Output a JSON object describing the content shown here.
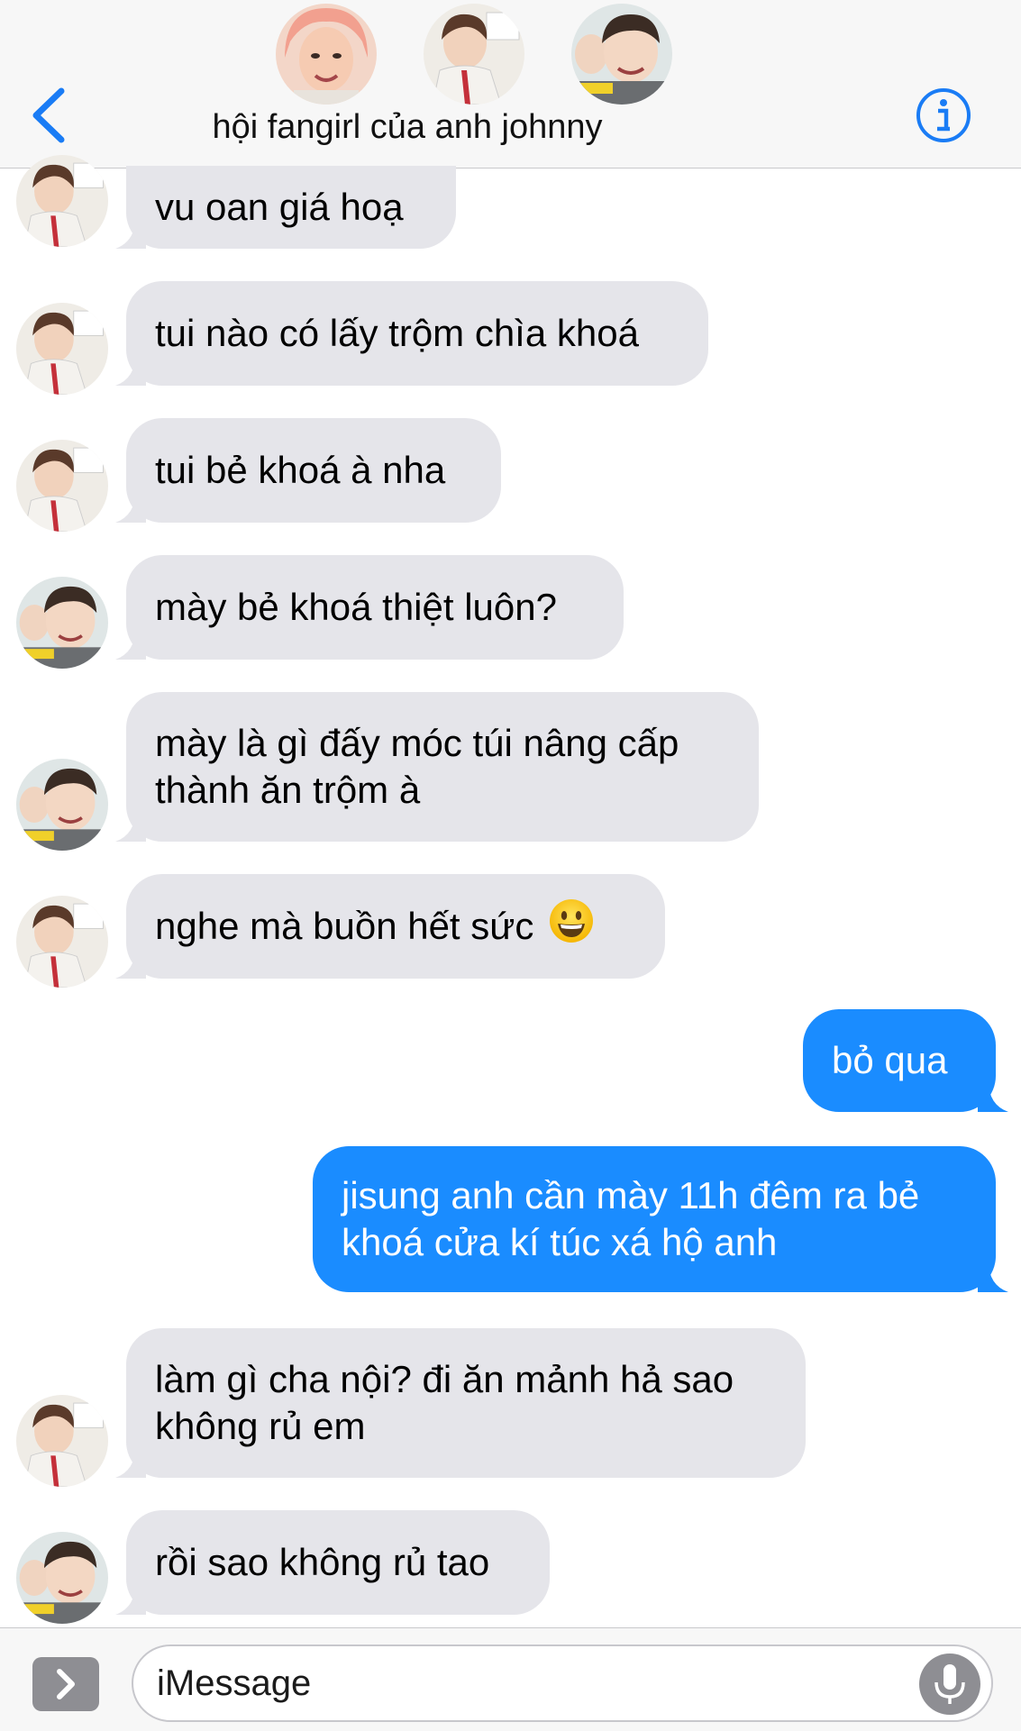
{
  "header": {
    "title": "hội fangirl của anh johnny",
    "back_icon": "chevron-left-icon",
    "info_icon": "info-icon",
    "accent": "#1a7cf5"
  },
  "messages": [
    {
      "dir": "in",
      "sender": "b",
      "lines": [
        "vu oan giá hoạ"
      ]
    },
    {
      "dir": "in",
      "sender": "b",
      "lines": [
        "tui nào có lấy trộm chìa khoá"
      ]
    },
    {
      "dir": "in",
      "sender": "b",
      "lines": [
        "tui bẻ khoá à nha"
      ]
    },
    {
      "dir": "in",
      "sender": "c",
      "lines": [
        "mày bẻ khoá thiệt luôn?"
      ]
    },
    {
      "dir": "in",
      "sender": "c",
      "lines": [
        "mày là gì đấy móc túi nâng cấp",
        "thành ăn trộm à"
      ]
    },
    {
      "dir": "in",
      "sender": "b",
      "lines": [
        "nghe mà buồn hết sức"
      ],
      "emoji": "grinning-face-icon"
    },
    {
      "dir": "out",
      "lines": [
        "bỏ qua"
      ]
    },
    {
      "dir": "out",
      "lines": [
        "jisung anh cần mày 11h đêm ra bẻ",
        "khoá cửa kí túc xá hộ anh"
      ]
    },
    {
      "dir": "in",
      "sender": "b",
      "lines": [
        "làm gì cha nội? đi ăn mảnh hả sao",
        "không rủ em"
      ]
    },
    {
      "dir": "in",
      "sender": "c",
      "lines": [
        "rồi sao không rủ tao"
      ]
    }
  ],
  "input": {
    "placeholder": "iMessage",
    "apps_icon": "chevron-right-icon",
    "mic_icon": "microphone-icon"
  },
  "colors": {
    "incoming_bubble": "#e5e5ea",
    "outgoing_bubble": "#1a8cff"
  }
}
